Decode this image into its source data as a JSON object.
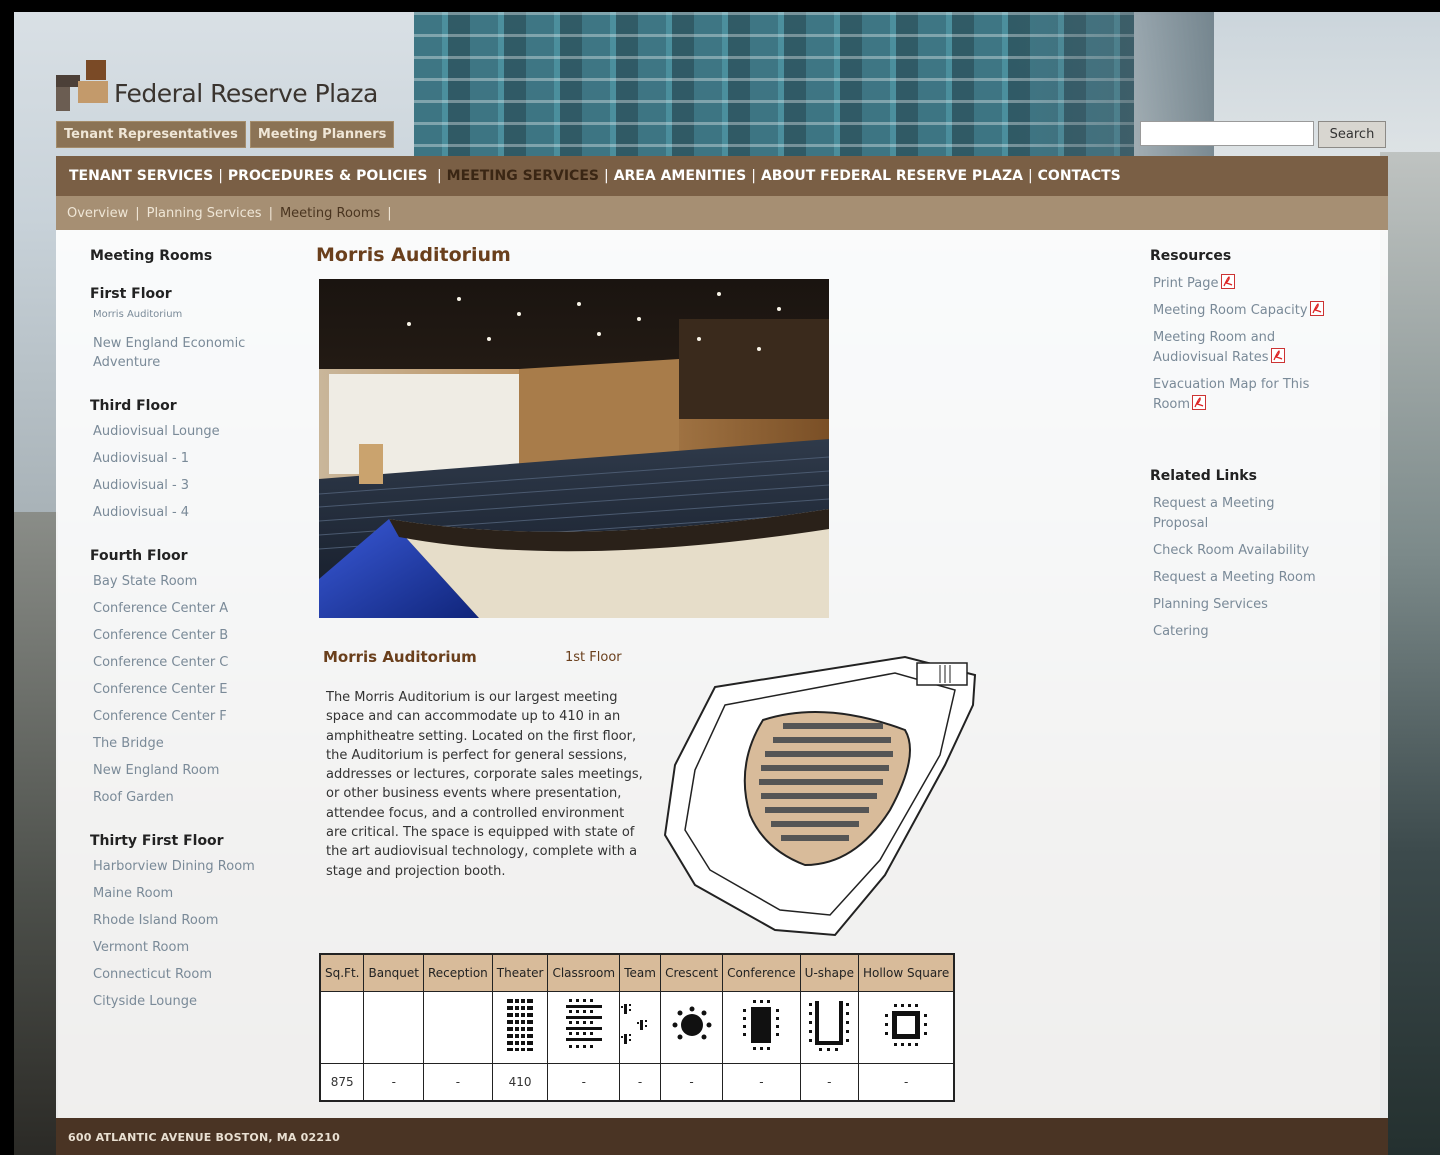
{
  "brand": {
    "name": "Federal Reserve Plaza"
  },
  "top_tabs": [
    "Tenant Representatives",
    "Meeting Planners"
  ],
  "search": {
    "button": "Search",
    "value": ""
  },
  "main_nav": [
    "TENANT SERVICES",
    "PROCEDURES & POLICIES",
    "MEETING SERVICES",
    "AREA AMENITIES",
    "ABOUT FEDERAL RESERVE PLAZA",
    "CONTACTS"
  ],
  "main_nav_active": "MEETING SERVICES",
  "sub_nav": [
    "Overview",
    "Planning Services",
    "Meeting Rooms"
  ],
  "sub_nav_active": "Meeting Rooms",
  "left_nav": {
    "title": "Meeting Rooms",
    "sections": [
      {
        "heading": "First Floor",
        "items": [
          "Morris Auditorium",
          "New England Economic Adventure"
        ]
      },
      {
        "heading": "Third Floor",
        "items": [
          "Audiovisual Lounge",
          "Audiovisual - 1",
          "Audiovisual - 3",
          "Audiovisual - 4"
        ]
      },
      {
        "heading": "Fourth Floor",
        "items": [
          "Bay State Room",
          "Conference Center A",
          "Conference Center B",
          "Conference Center C",
          "Conference Center E",
          "Conference Center F",
          "The Bridge",
          "New England Room",
          "Roof Garden"
        ]
      },
      {
        "heading": "Thirty First Floor",
        "items": [
          "Harborview Dining Room",
          "Maine Room",
          "Rhode Island Room",
          "Vermont Room",
          "Connecticut Room",
          "Cityside Lounge"
        ]
      }
    ]
  },
  "main": {
    "title": "Morris Auditorium",
    "room_name": "Morris Auditorium",
    "floor": "1st Floor",
    "description": "The Morris Auditorium is our largest meeting space and can accommodate up to 410 in an amphitheatre setting.  Located on the first floor, the Auditorium is perfect for general sessions, addresses or lectures, corporate sales meetings, or other business events where presentation, attendee focus, and a controlled environment are critical.  The space is equipped with state of the art audiovisual technology, complete with a stage and projection booth."
  },
  "capacity": {
    "headers": [
      "Sq.Ft.",
      "Banquet",
      "Reception",
      "Theater",
      "Classroom",
      "Team",
      "Crescent",
      "Conference",
      "U-shape",
      "Hollow Square"
    ],
    "values": [
      "875",
      "-",
      "-",
      "410",
      "-",
      "-",
      "-",
      "-",
      "-",
      "-"
    ],
    "icons": [
      "",
      "",
      "",
      "theater-layout-icon",
      "classroom-layout-icon",
      "team-layout-icon",
      "crescent-layout-icon",
      "conference-layout-icon",
      "u-shape-layout-icon",
      "hollow-square-layout-icon"
    ]
  },
  "resources": {
    "heading": "Resources",
    "links": [
      "Print Page",
      "Meeting Room Capacity",
      "Meeting Room and Audiovisual Rates",
      "Evacuation Map for This Room"
    ]
  },
  "related": {
    "heading": "Related Links",
    "links": [
      "Request a Meeting Proposal",
      "Check Room Availability",
      "Request a Meeting Room",
      "Planning Services",
      "Catering"
    ]
  },
  "footer": {
    "address": "600 ATLANTIC AVENUE BOSTON, MA 02210"
  },
  "colors": {
    "nav_brown": "#7a5f45",
    "subnav_tan": "#a68f73",
    "title_brown": "#6a3f1c",
    "link_gray": "#7a8a98",
    "table_header": "#d8bb9a",
    "footer_brown": "#4a3424"
  }
}
